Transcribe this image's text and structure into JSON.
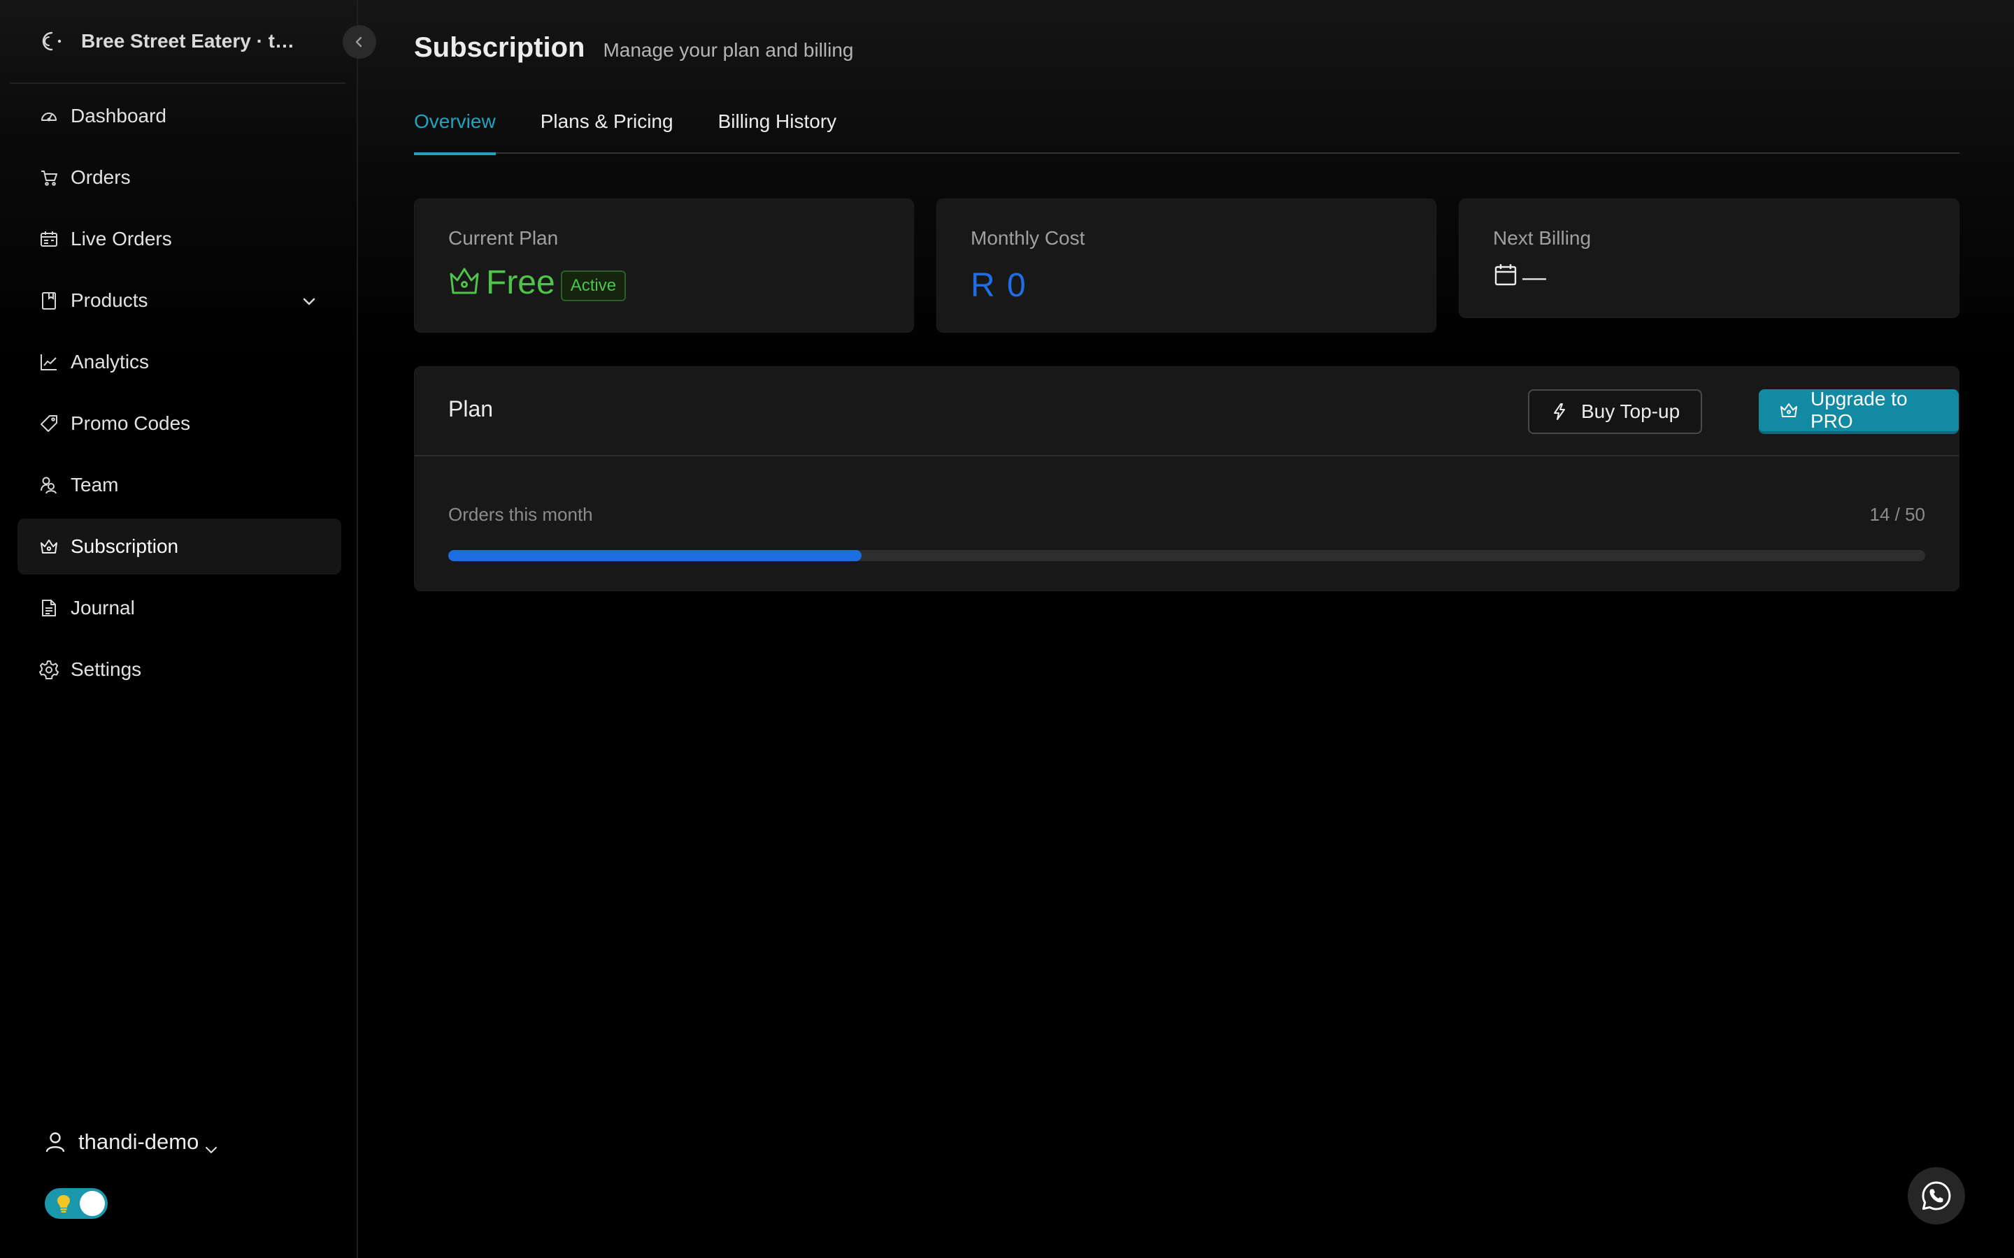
{
  "brand": {
    "name": "Bree Street Eatery · thandi-demo"
  },
  "sidebar": {
    "items": [
      {
        "label": "Dashboard",
        "icon": "dashboard-icon"
      },
      {
        "label": "Orders",
        "icon": "cart-icon"
      },
      {
        "label": "Live Orders",
        "icon": "live-orders-icon"
      },
      {
        "label": "Products",
        "icon": "book-icon",
        "expandable": true
      },
      {
        "label": "Analytics",
        "icon": "chart-line-icon"
      },
      {
        "label": "Promo Codes",
        "icon": "tag-icon"
      },
      {
        "label": "Team",
        "icon": "team-icon"
      },
      {
        "label": "Subscription",
        "icon": "crown-icon",
        "active": true
      },
      {
        "label": "Journal",
        "icon": "document-icon"
      },
      {
        "label": "Settings",
        "icon": "gear-icon"
      }
    ],
    "user": {
      "name": "thandi-demo"
    },
    "theme_toggle": {
      "on": true
    }
  },
  "header": {
    "title": "Subscription",
    "subtitle": "Manage your plan and billing"
  },
  "tabs": [
    {
      "label": "Overview",
      "active": true
    },
    {
      "label": "Plans & Pricing",
      "active": false
    },
    {
      "label": "Billing History",
      "active": false
    }
  ],
  "summary": {
    "current_plan": {
      "label": "Current Plan",
      "value": "Free",
      "badge": "Active"
    },
    "monthly_cost": {
      "label": "Monthly Cost",
      "value": "R 0"
    },
    "next_billing": {
      "label": "Next Billing",
      "value": "—"
    }
  },
  "plan": {
    "title": "Plan",
    "topup_label": "Buy Top-up",
    "upgrade_label": "Upgrade to PRO",
    "usage_label": "Orders this month",
    "usage_text": "14 / 50",
    "usage_used": 14,
    "usage_limit": 50
  },
  "colors": {
    "accent": "#1fa3bf",
    "plan_green": "#4ec44a",
    "cost_blue": "#1e6ee8",
    "progress_blue": "#1c6de0",
    "primary_button": "#138aa3"
  }
}
